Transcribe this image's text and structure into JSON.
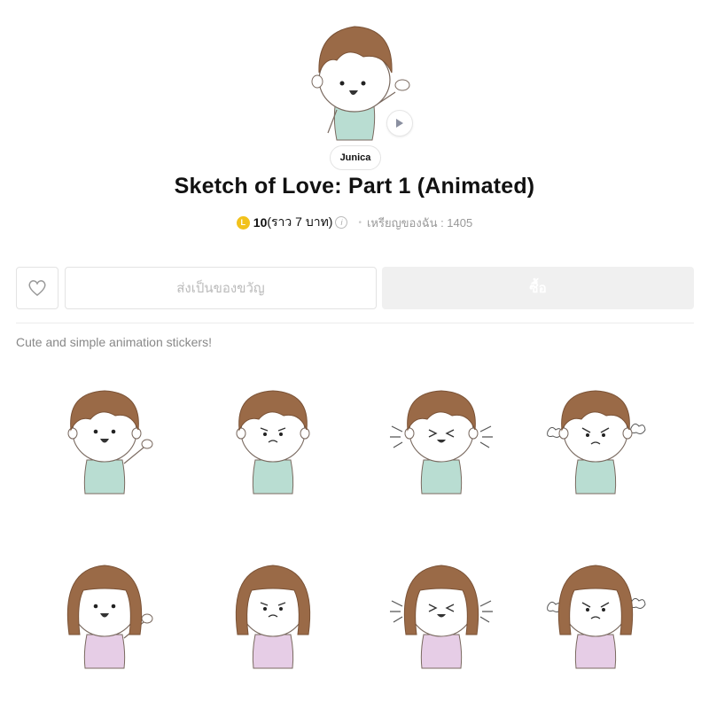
{
  "author": "Junica",
  "title": "Sketch of Love: Part 1 (Animated)",
  "price": {
    "coin_letter": "L",
    "amount": "10",
    "approx": "(ราว 7 บาท)",
    "my_coins": "เหรียญของฉัน : 1405"
  },
  "actions": {
    "gift_label": "ส่งเป็นของขวัญ",
    "buy_label": "ซื้อ"
  },
  "description": "Cute and simple animation stickers!",
  "stickers": [
    {
      "name": "boy-waving",
      "character": "boy",
      "mood": "happy-wave"
    },
    {
      "name": "boy-shy",
      "character": "boy",
      "mood": "shy"
    },
    {
      "name": "boy-laughing",
      "character": "boy",
      "mood": "laugh"
    },
    {
      "name": "boy-angry",
      "character": "boy",
      "mood": "angry"
    },
    {
      "name": "girl-waving",
      "character": "girl",
      "mood": "happy-wave"
    },
    {
      "name": "girl-shy",
      "character": "girl",
      "mood": "shy"
    },
    {
      "name": "girl-laughing",
      "character": "girl",
      "mood": "laugh"
    },
    {
      "name": "girl-angry",
      "character": "girl",
      "mood": "angry"
    }
  ],
  "colors": {
    "hair": "#9a6a47",
    "boy_shirt": "#b9ddd2",
    "girl_dress": "#e6cde6",
    "coin": "#f2c21c"
  }
}
